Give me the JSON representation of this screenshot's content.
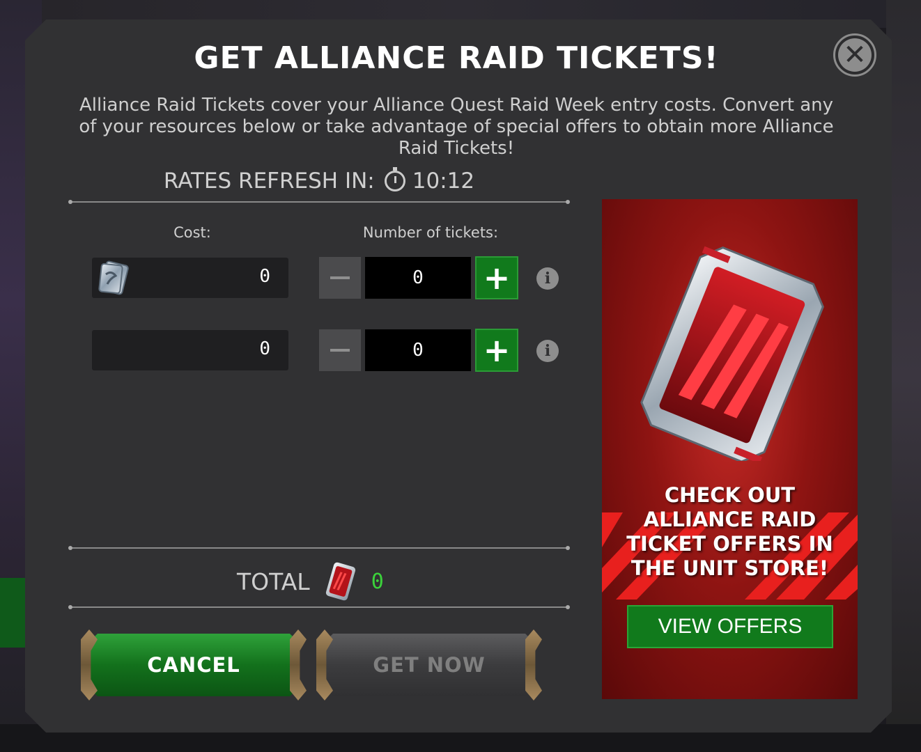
{
  "dialog": {
    "title": "GET ALLIANCE RAID TICKETS!",
    "description": "Alliance Raid Tickets cover your Alliance Quest Raid Week entry costs. Convert any of your resources below or take advantage of special offers to obtain more Alliance Raid Tickets!",
    "close_icon": "close-icon"
  },
  "rates": {
    "label": "RATES REFRESH IN:",
    "timer_icon": "stopwatch-icon",
    "timer": "10:12"
  },
  "columns": {
    "cost_label": "Cost:",
    "tickets_label": "Number of tickets:"
  },
  "rows": [
    {
      "cost_icon": "silver-ticket-icon",
      "cost_value": "0",
      "ticket_count": "0",
      "minus": "−",
      "plus": "+",
      "info": "i"
    },
    {
      "cost_icon": "",
      "cost_value": "0",
      "ticket_count": "0",
      "minus": "−",
      "plus": "+",
      "info": "i"
    }
  ],
  "total": {
    "label": "TOTAL",
    "icon": "raid-ticket-icon",
    "value": "0",
    "value_color": "#3bd23b"
  },
  "buttons": {
    "cancel": "CANCEL",
    "get_now": "GET NOW"
  },
  "promo": {
    "text_lines": [
      "CHECK OUT",
      "ALLIANCE RAID",
      "TICKET OFFERS IN",
      "THE UNIT STORE!"
    ],
    "button": "VIEW OFFERS"
  },
  "colors": {
    "accent_green": "#117a1c",
    "panel_bg": "#313133",
    "promo_red": "#c52a26"
  }
}
